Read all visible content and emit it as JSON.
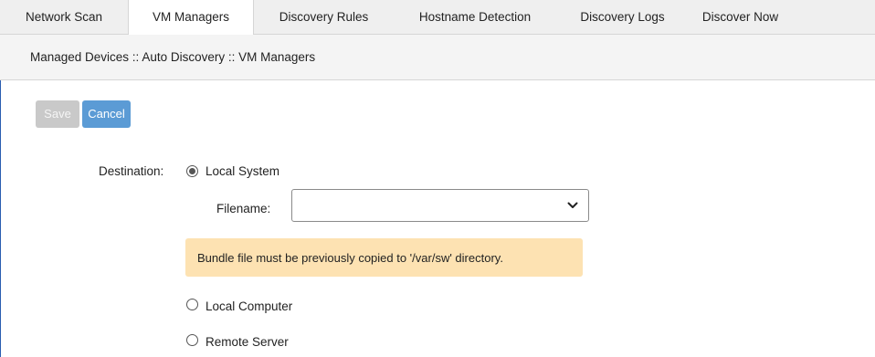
{
  "tabs": [
    {
      "label": "Network Scan",
      "active": false
    },
    {
      "label": "VM Managers",
      "active": true
    },
    {
      "label": "Discovery Rules",
      "active": false
    },
    {
      "label": "Hostname Detection",
      "active": false
    },
    {
      "label": "Discovery Logs",
      "active": false
    },
    {
      "label": "Discover Now",
      "active": false
    }
  ],
  "breadcrumb": "Managed Devices :: Auto Discovery :: VM Managers",
  "toolbar": {
    "save_label": "Save",
    "save_enabled": false,
    "cancel_label": "Cancel"
  },
  "form": {
    "destination_label": "Destination:",
    "options": [
      {
        "label": "Local System",
        "selected": true
      },
      {
        "label": "Local Computer",
        "selected": false
      },
      {
        "label": "Remote Server",
        "selected": false
      }
    ],
    "filename_label": "Filename:",
    "filename_value": "",
    "notice": "Bundle file must be previously copied to '/var/sw' directory."
  },
  "colors": {
    "accent": "#5b9bd5",
    "disabled": "#c9c9c9",
    "notice_bg": "#fde2b2",
    "tab_bg": "#efefef",
    "frame_border": "#2a5db0"
  }
}
